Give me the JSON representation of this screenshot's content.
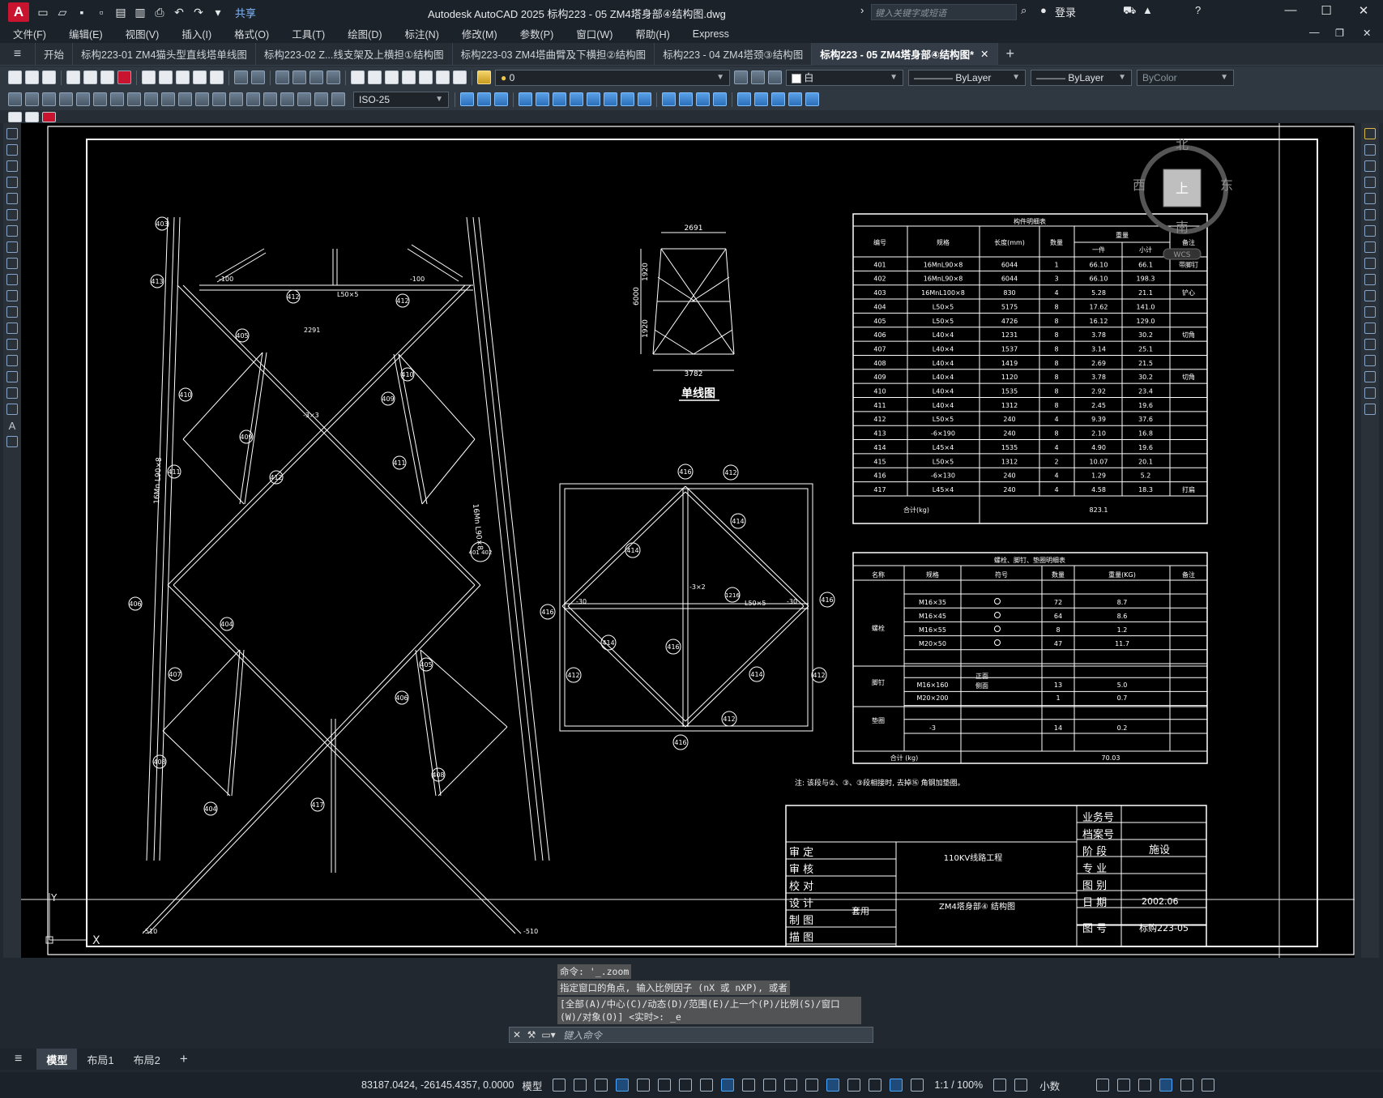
{
  "titlebar": {
    "app_title": "Autodesk AutoCAD 2025    标构223 - 05 ZM4塔身部④结构图.dwg",
    "share": "共享",
    "search_placeholder": "键入关键字或短语",
    "login": "登录",
    "minimize": "—",
    "maximize": "☐",
    "close": "✕"
  },
  "menubar": [
    "文件(F)",
    "编辑(E)",
    "视图(V)",
    "插入(I)",
    "格式(O)",
    "工具(T)",
    "绘图(D)",
    "标注(N)",
    "修改(M)",
    "参数(P)",
    "窗口(W)",
    "帮助(H)",
    "Express"
  ],
  "tabs": [
    "开始",
    "标构223-01 ZM4猫头型直线塔单线图",
    "标构223-02 Z...线支架及上横担①结构图",
    "标构223-03 ZM4塔曲臂及下横担②结构图",
    "标构223 - 04 ZM4塔颈③结构图",
    "标构223 - 05 ZM4塔身部④结构图*"
  ],
  "toolbar": {
    "layer": "0",
    "color": "白",
    "linetype": "ByLayer",
    "lineweight": "ByLayer",
    "plotstyle": "ByColor",
    "dimstyle": "ISO-25"
  },
  "viewcube": {
    "north": "北",
    "south": "南",
    "east": "东",
    "west": "西",
    "top": "上",
    "wcs": "WCS"
  },
  "drawing": {
    "single_line_title": "单线图",
    "sl_top": "2691",
    "sl_bottom": "3782",
    "sl_h": "6000",
    "sl_h1": "1920",
    "sl_h2": "1920",
    "parts_title": "构件明细表",
    "parts_headers": [
      "编号",
      "规格",
      "长度(mm)",
      "数量",
      "重量",
      "一件",
      "小计",
      "备注"
    ],
    "parts_rows": [
      [
        "401",
        "16MnL90×8",
        "6044",
        "1",
        "66.10",
        "66.1",
        "带脚钉"
      ],
      [
        "402",
        "16MnL90×8",
        "6044",
        "3",
        "66.10",
        "198.3",
        ""
      ],
      [
        "403",
        "16MnL100×8",
        "830",
        "4",
        "5.28",
        "21.1",
        "铲心"
      ],
      [
        "404",
        "L50×5",
        "5175",
        "8",
        "17.62",
        "141.0",
        ""
      ],
      [
        "405",
        "L50×5",
        "4726",
        "8",
        "16.12",
        "129.0",
        ""
      ],
      [
        "406",
        "L40×4",
        "1231",
        "8",
        "3.78",
        "30.2",
        "切角"
      ],
      [
        "407",
        "L40×4",
        "1537",
        "8",
        "3.14",
        "25.1",
        ""
      ],
      [
        "408",
        "L40×4",
        "1419",
        "8",
        "2.69",
        "21.5",
        ""
      ],
      [
        "409",
        "L40×4",
        "1120",
        "8",
        "3.78",
        "30.2",
        "切角"
      ],
      [
        "410",
        "L40×4",
        "1535",
        "8",
        "2.92",
        "23.4",
        ""
      ],
      [
        "411",
        "L40×4",
        "1312",
        "8",
        "2.45",
        "19.6",
        ""
      ],
      [
        "412",
        "L50×5",
        "240",
        "4",
        "9.39",
        "37.6",
        ""
      ],
      [
        "413",
        "-6×190",
        "240",
        "8",
        "2.10",
        "16.8",
        ""
      ],
      [
        "414",
        "L45×4",
        "1535",
        "4",
        "4.90",
        "19.6",
        ""
      ],
      [
        "415",
        "L50×5",
        "1312",
        "2",
        "10.07",
        "20.1",
        ""
      ],
      [
        "416",
        "-6×130",
        "240",
        "4",
        "1.29",
        "5.2",
        ""
      ],
      [
        "417",
        "L45×4",
        "240",
        "4",
        "4.58",
        "18.3",
        "打扁"
      ]
    ],
    "parts_total_label": "合计(kg)",
    "parts_total": "823.1",
    "bolt_title": "螺栓、脚钉、垫圈明细表",
    "bolt_headers": [
      "名称",
      "规格",
      "符号",
      "数量",
      "重量(KG)",
      "备注"
    ],
    "bolt_rows": [
      [
        "螺栓",
        "M16×35",
        "72",
        "8.7"
      ],
      [
        "",
        "M16×45",
        "64",
        "8.6"
      ],
      [
        "",
        "M16×55",
        "8",
        "1.2"
      ],
      [
        "",
        "M20×50",
        "47",
        "11.7"
      ],
      [
        "脚钉",
        "M16×160",
        "13",
        "5.0"
      ],
      [
        "",
        "M20×200",
        "1",
        "0.7"
      ],
      [
        "垫圈",
        "-3",
        "14",
        "0.2"
      ]
    ],
    "bolt_front": "正面",
    "bolt_side": "侧面",
    "bolt_total_label": "合计 (kg)",
    "bolt_total": "70.03",
    "note": "注: 该段与②、③、③段相接时, 去掉⑯ 角钢加垫圈。",
    "tb": {
      "shending": "审  定",
      "shenhe": "审  核",
      "jiaodui": "校  对",
      "sheji": "设  计",
      "zhitu": "制  图",
      "miaotu": "描  图",
      "project": "110KV线路工程",
      "drawing_name": "ZM4塔身部④ 结构图",
      "reuse": "套用",
      "yewu": "业务号",
      "dangan": "档案号",
      "jieduan": "阶  段",
      "jieduan_v": "施设",
      "zhuanye": "专  业",
      "tubie": "图  别",
      "riqi": "日  期",
      "riqi_v": "2002.06",
      "tuhao": "图  号",
      "tuhao_v": "标购223-05"
    },
    "tower_labels": [
      "403",
      "413",
      "412",
      "412",
      "405",
      "410",
      "409",
      "411",
      "406",
      "404",
      "407",
      "408",
      "404",
      "417",
      "405",
      "406",
      "408",
      "409",
      "410",
      "411",
      "412",
      "401 402"
    ],
    "plan_labels": [
      "416",
      "412",
      "414",
      "414",
      "416",
      "416",
      "412",
      "414",
      "416",
      "416",
      "412",
      "412",
      "414",
      "1216"
    ]
  },
  "command": {
    "history": [
      "命令: '_.zoom",
      "指定窗口的角点, 输入比例因子 (nX 或 nXP), 或者",
      "[全部(A)/中心(C)/动态(D)/范围(E)/上一个(P)/比例(S)/窗口(W)/对象(O)] <实时>: _e"
    ],
    "placeholder": "键入命令"
  },
  "layouts": [
    "模型",
    "布局1",
    "布局2"
  ],
  "status": {
    "coords": "83187.0424, -26145.4357, 0.0000",
    "model": "模型",
    "scale": "1:1 / 100%",
    "units": "小数"
  }
}
